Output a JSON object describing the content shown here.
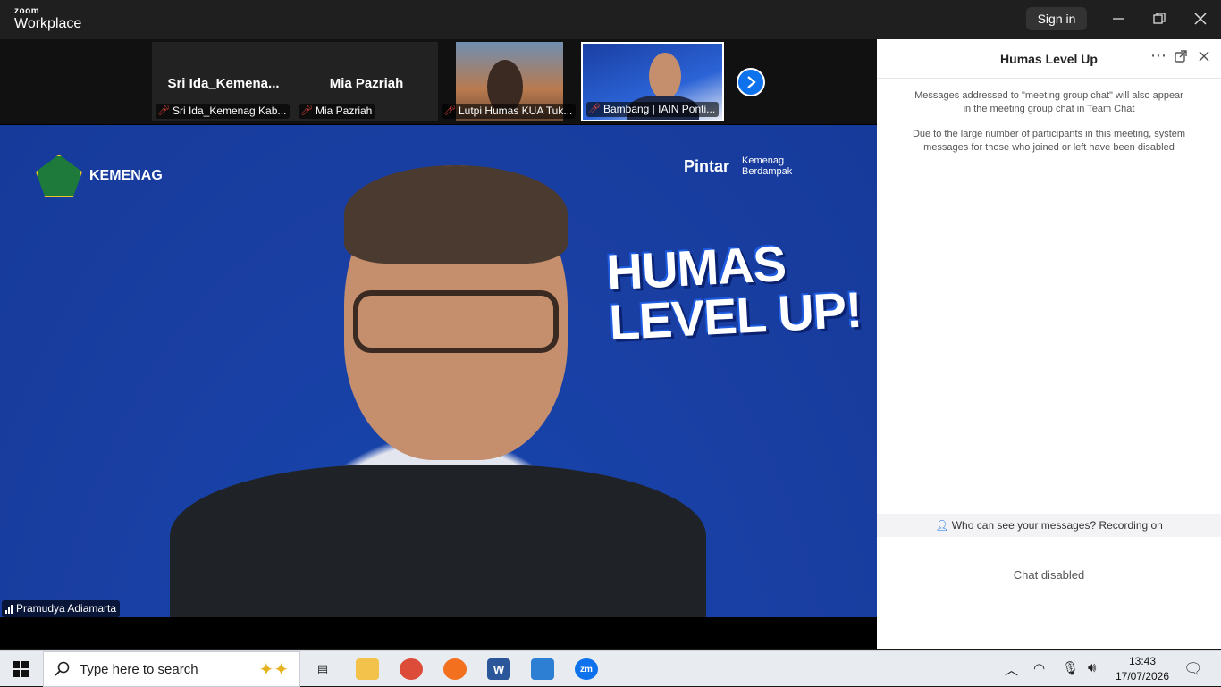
{
  "app": {
    "logo_top": "zoom",
    "logo_bottom": "Workplace",
    "sign_in": "Sign in"
  },
  "participants": [
    {
      "tile_name": "Sri  Ida_Kemena...",
      "caption": "Sri Ida_Kemenag Kab..."
    },
    {
      "tile_name": "Mia Pazriah",
      "caption": "Mia Pazriah"
    },
    {
      "caption": "Lutpi Humas KUA Tuk..."
    },
    {
      "caption": "Bambang | IAIN Ponti..."
    }
  ],
  "active_speaker": {
    "caption": "Pramudya Adiamarta",
    "backdrop": {
      "org": "KEMENAG",
      "brand1": "Pintar",
      "brand2_line1": "Kemenag",
      "brand2_line2": "Berdampak",
      "headline_line1": "HUMAS",
      "headline_line2": "LEVEL UP!"
    }
  },
  "chat": {
    "title": "Humas Level Up",
    "system_messages": [
      "Messages addressed to \"meeting group chat\" will also appear in the meeting group chat in Team Chat",
      "Due to the large number of participants in this meeting, system messages for those who joined or left have been disabled"
    ],
    "visibility": "Who can see your messages? Recording on",
    "status": "Chat disabled"
  },
  "taskbar": {
    "search_placeholder": "Type here to search",
    "time": "13:43",
    "date": "17/07/2026"
  },
  "colors": {
    "zoom_blue": "#0e72ed",
    "backdrop_blue": "#1a3fa3",
    "mic_off": "#e0453a"
  }
}
